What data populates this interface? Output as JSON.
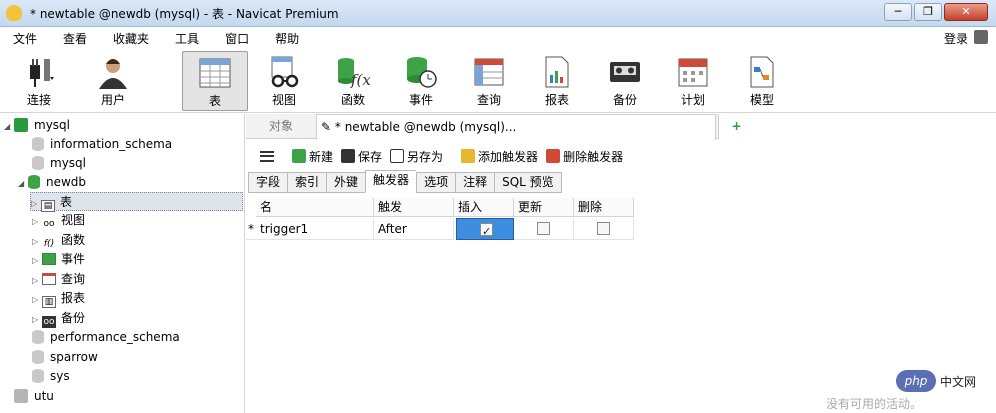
{
  "window": {
    "title": "* newtable @newdb (mysql) - 表 - Navicat Premium"
  },
  "menu": {
    "items": [
      "文件",
      "查看",
      "收藏夹",
      "工具",
      "窗口",
      "帮助"
    ],
    "login": "登录"
  },
  "toolbar": {
    "items": [
      "连接",
      "用户",
      "表",
      "视图",
      "函数",
      "事件",
      "查询",
      "报表",
      "备份",
      "计划",
      "模型"
    ]
  },
  "tree": {
    "conn1": "mysql",
    "db_information_schema": "information_schema",
    "db_mysql": "mysql",
    "db_newdb": "newdb",
    "node_table": "表",
    "node_view": "视图",
    "node_func": "函数",
    "node_event": "事件",
    "node_query": "查询",
    "node_report": "报表",
    "node_backup": "备份",
    "db_performance_schema": "performance_schema",
    "db_sparrow": "sparrow",
    "db_sys": "sys",
    "conn2": "utu"
  },
  "tabs": {
    "objects": "对象",
    "doc": "* newtable @newdb (mysql)..."
  },
  "actions": {
    "new": "新建",
    "save": "保存",
    "save_as": "另存为",
    "add_trigger": "添加触发器",
    "delete_trigger": "删除触发器"
  },
  "subtabs": [
    "字段",
    "索引",
    "外键",
    "触发器",
    "选项",
    "注释",
    "SQL 预览"
  ],
  "grid": {
    "headers": [
      "名",
      "触发",
      "插入",
      "更新",
      "删除"
    ],
    "row_marker": "*",
    "row": {
      "name": "trigger1",
      "fires": "After",
      "insert": true,
      "update": false,
      "delete": false
    }
  },
  "watermark": {
    "php": "php",
    "site": "中文网",
    "status": "没有可用的活动。"
  }
}
